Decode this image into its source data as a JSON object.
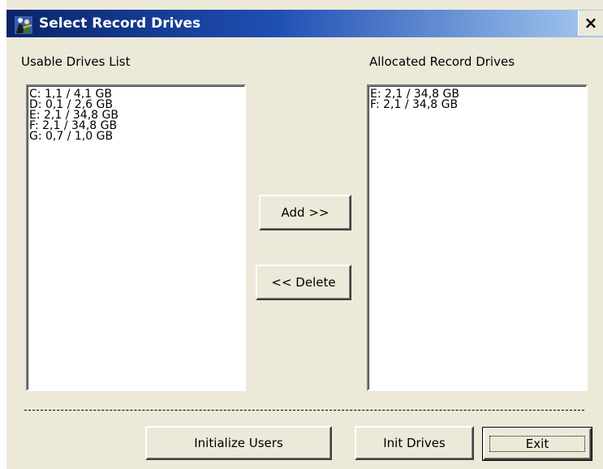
{
  "window": {
    "title": "Select Record Drives",
    "close_label": "×"
  },
  "usable": {
    "label": "Usable Drives List",
    "items": [
      "C: 1,1 / 4,1 GB",
      "D: 0,1 / 2,6 GB",
      "E: 2,1 / 34,8 GB",
      "F: 2,1 / 34,8 GB",
      "G: 0,7 / 1,0 GB"
    ]
  },
  "allocated": {
    "label": "Allocated Record Drives",
    "items": [
      "E: 2,1 / 34,8 GB",
      "F: 2,1 / 34,8 GB"
    ]
  },
  "buttons": {
    "add": "Add >>",
    "delete": "<< Delete",
    "init_users": "Initialize Users",
    "init_drives": "Init Drives",
    "exit": "Exit"
  },
  "icons": {
    "app": "app-people-icon",
    "close": "close-icon"
  }
}
